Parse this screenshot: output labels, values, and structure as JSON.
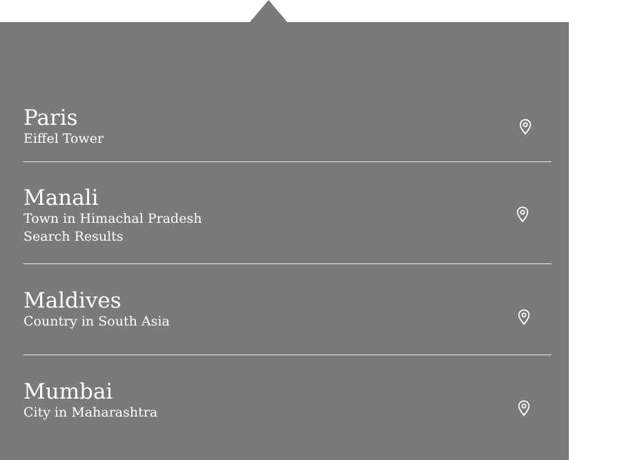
{
  "results": [
    {
      "title": "Paris",
      "lines": [
        "Eiffel Tower"
      ],
      "icon": "map-pin-icon"
    },
    {
      "title": "Manali",
      "lines": [
        "Town in Himachal Pradesh",
        "Search Results"
      ],
      "icon": "map-pin-icon"
    },
    {
      "title": "Maldives",
      "lines": [
        "Country in South Asia"
      ],
      "icon": "map-pin-icon"
    },
    {
      "title": "Mumbai",
      "lines": [
        "City in Maharashtra"
      ],
      "icon": "map-pin-icon"
    }
  ],
  "colors": {
    "panel_bg": "#7a7a7a",
    "text": "#ffffff",
    "divider": "#e9e9e9"
  }
}
